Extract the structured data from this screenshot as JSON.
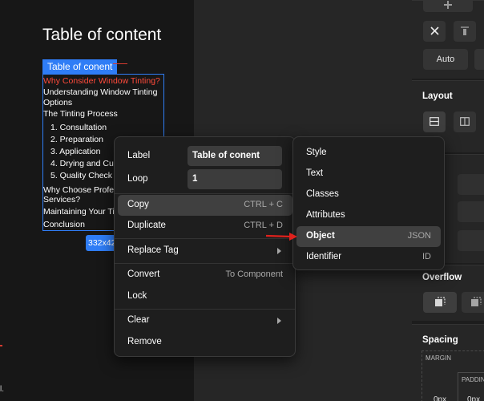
{
  "canvas": {
    "page_title": "Table of content",
    "selection_tag": "Table of conent",
    "size_badge": "332x42",
    "corner_text": "l.",
    "toc": {
      "item1": "Why Consider Window Tinting?",
      "item2": "Understanding Window Tinting Options",
      "item3": "The Tinting Process",
      "sub1": "1. Consultation",
      "sub2": "2. Preparation",
      "sub3": "3. Application",
      "sub4": "4. Drying and Cur",
      "sub5": "5. Quality Check",
      "item4": "Why Choose Profes",
      "item4b": "Services?",
      "item5": "Maintaining Your Tin",
      "item6": "Conclusion"
    }
  },
  "panel": {
    "auto_label": "Auto",
    "layout_heading": "Layout",
    "overflow_heading": "Overflow",
    "spacing_heading": "Spacing",
    "margin_label": "MARGIN",
    "padding_label": "PADDING",
    "px1": "0px",
    "px2": "0px"
  },
  "context_menu": {
    "label_field": "Label",
    "label_value": "Table of conent",
    "loop_field": "Loop",
    "loop_value": "1",
    "copy": "Copy",
    "copy_shortcut": "CTRL + C",
    "duplicate": "Duplicate",
    "duplicate_shortcut": "CTRL + D",
    "replace_tag": "Replace Tag",
    "convert": "Convert",
    "convert_hint": "To Component",
    "lock": "Lock",
    "clear": "Clear",
    "remove": "Remove"
  },
  "submenu": {
    "style": "Style",
    "text": "Text",
    "classes": "Classes",
    "attributes": "Attributes",
    "object": "Object",
    "object_hint": "JSON",
    "identifier": "Identifier",
    "identifier_hint": "ID"
  },
  "colors": {
    "accent": "#2f7df6",
    "highlight": "#ff4a3a",
    "arrow": "#e0211c"
  }
}
